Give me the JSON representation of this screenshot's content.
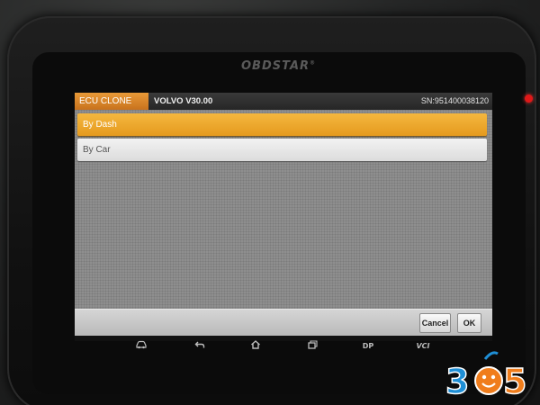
{
  "device": {
    "brand": "OBDSTAR",
    "brand_mark": "®",
    "led_color": "#e01818"
  },
  "header": {
    "tab_title": "ECU CLONE",
    "vehicle": "VOLVO  V30.00",
    "serial": "SN:951400038120"
  },
  "menu": {
    "items": [
      {
        "label": "By Dash",
        "selected": true
      },
      {
        "label": "By Car",
        "selected": false
      }
    ]
  },
  "footer": {
    "cancel_label": "Cancel",
    "ok_label": "OK"
  },
  "sys_nav": {
    "dp_label": "DP",
    "vci_label": "VCI",
    "icons": [
      "car-icon",
      "back-icon",
      "home-icon",
      "recent-apps-icon"
    ]
  },
  "watermark": {
    "text_left": "3",
    "text_right": "5",
    "colors": {
      "blue": "#1f8fd6",
      "orange": "#f07d1c"
    }
  },
  "colors": {
    "accent_orange": "#e99a38",
    "selected_item": "#f4b73f",
    "panel_gray": "#8e8e8e"
  }
}
